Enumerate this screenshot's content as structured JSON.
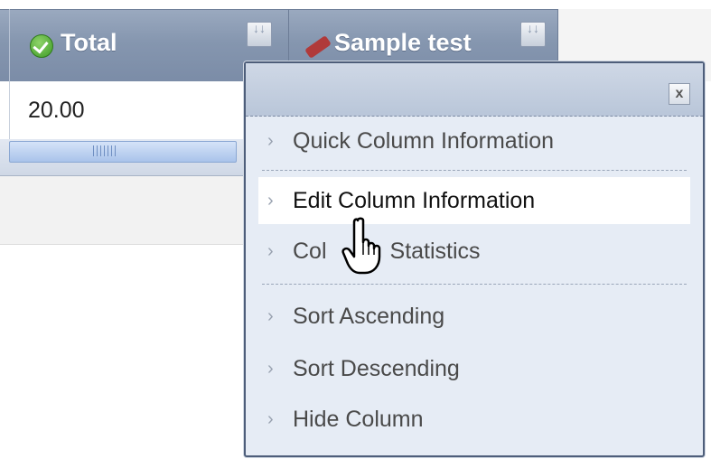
{
  "grid": {
    "columns": [
      {
        "label": "Total",
        "icon": "check-icon"
      },
      {
        "label": "Sample test",
        "icon": "pencil-icon"
      }
    ],
    "rows": [
      {
        "total": "20.00"
      }
    ]
  },
  "context_menu": {
    "close_label": "x",
    "items": [
      {
        "label": "Quick Column Information"
      },
      {
        "label": "Edit Column Information"
      },
      {
        "label": "Column Statistics"
      },
      {
        "label": "Sort Ascending"
      },
      {
        "label": "Sort Descending"
      },
      {
        "label": "Hide Column"
      }
    ],
    "highlighted_item": "Edit Column Information",
    "occluded_item_label": {
      "prefix": "Col",
      "suffix": "Statistics"
    }
  },
  "colors": {
    "header_bg": "#8596af",
    "menu_bg": "#e6ecf5",
    "menu_border": "#4e5e7a",
    "highlight_bg": "#ffffff"
  }
}
